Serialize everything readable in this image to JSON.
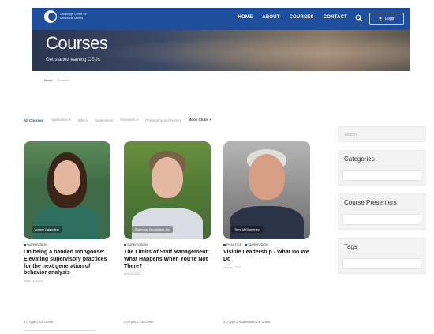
{
  "nav": {
    "logo_text": "Cambridge Center for Behavioral Studies",
    "links": [
      "HOME",
      "ABOUT",
      "COURSES",
      "CONTACT"
    ],
    "login_label": "Login"
  },
  "hero": {
    "title": "Courses",
    "subtitle": "Get started earning CEUs"
  },
  "breadcrumb": [
    "Home",
    "Courses"
  ],
  "filters": [
    "All Courses",
    "Application",
    "Ethics",
    "Supervision",
    "Research",
    "Philosophy and History",
    "Book Clubs"
  ],
  "courses": [
    {
      "presenter": "Amber Calendine",
      "tags": [
        "SUPERVISION"
      ],
      "title": "On being a banded mongoose: Elevating supervisory practices for the next generation of behavior analysis",
      "date": "June 14, 2023",
      "meta": "3.0 Type 2 CE Credit"
    },
    {
      "presenter": "Raymond Brookbank-Ho",
      "tags": [
        "SUPERVISION"
      ],
      "title": "The Limits of Staff Management: What Happens When You're Not There?",
      "date": "April 5, 2023",
      "meta": "3.0 Type 2 CE Credit"
    },
    {
      "presenter": "Terry McSweeney",
      "tags": [
        "PRACTICE",
        "SUPERVISION"
      ],
      "title": "Visible Leadership - What Do We Do",
      "date": "June 6, 2022",
      "meta": "3.0 Type 2 Supervision CE Credit"
    }
  ],
  "sidebar": {
    "search_placeholder": "Search",
    "widgets": [
      "Categories",
      "Course Presenters",
      "Tags"
    ]
  },
  "colors": {
    "brand": "#1f4e9c"
  }
}
